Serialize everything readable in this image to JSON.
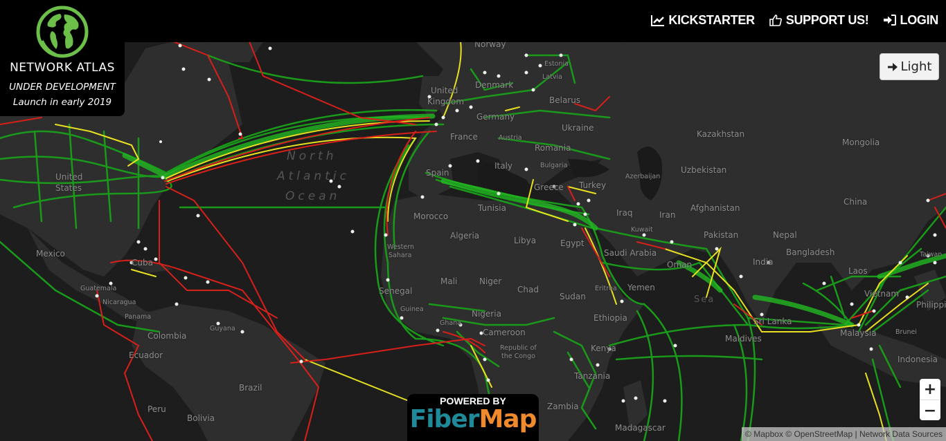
{
  "brand": {
    "title": "NETWORK ATLAS",
    "subtitle_line1": "UNDER DEVELOPMENT",
    "subtitle_line2": "Launch in early 2019",
    "logo_icon": "globe-logo-icon",
    "logo_color": "#6cc04a"
  },
  "nav": {
    "items": [
      {
        "label": "KICKSTARTER",
        "icon": "chart-line-icon"
      },
      {
        "label": "SUPPORT US!",
        "icon": "thumbs-up-icon"
      },
      {
        "label": "LOGIN",
        "icon": "sign-in-icon"
      }
    ]
  },
  "map": {
    "theme_toggle_label": "Light",
    "theme_toggle_icon": "arrow-right-icon",
    "zoom_in_label": "+",
    "zoom_out_label": "−",
    "attribution": {
      "mapbox": "© Mapbox",
      "osm": "© OpenStreetMap",
      "separator": " | ",
      "sources": "Network Data Sources"
    },
    "ocean_label": [
      "North",
      "Atlantic",
      "Ocean"
    ],
    "country_labels": [
      {
        "name": "Norway"
      },
      {
        "name": "Estonia"
      },
      {
        "name": "Latvia"
      },
      {
        "name": "Denmark"
      },
      {
        "name": "United"
      },
      {
        "name": "Kingdom"
      },
      {
        "name": "Belarus"
      },
      {
        "name": "Germany"
      },
      {
        "name": "Ukraine"
      },
      {
        "name": "France"
      },
      {
        "name": "Austria"
      },
      {
        "name": "Romania"
      },
      {
        "name": "Kazakhstan"
      },
      {
        "name": "Mongolia"
      },
      {
        "name": "Spain"
      },
      {
        "name": "Italy"
      },
      {
        "name": "Bulgaria"
      },
      {
        "name": "Uzbekistan"
      },
      {
        "name": "United"
      },
      {
        "name": "States"
      },
      {
        "name": "Greece"
      },
      {
        "name": "Turkey"
      },
      {
        "name": "Azerbaijan"
      },
      {
        "name": "Afghanistan"
      },
      {
        "name": "China"
      },
      {
        "name": "Tunisia"
      },
      {
        "name": "Morocco"
      },
      {
        "name": "Iraq"
      },
      {
        "name": "Iran"
      },
      {
        "name": "Kuwait"
      },
      {
        "name": "Pakistan"
      },
      {
        "name": "Nepal"
      },
      {
        "name": "Mexico"
      },
      {
        "name": "Algeria"
      },
      {
        "name": "Libya"
      },
      {
        "name": "Egypt"
      },
      {
        "name": "Saudi Arabia"
      },
      {
        "name": "Bangladesh"
      },
      {
        "name": "India"
      },
      {
        "name": "Western"
      },
      {
        "name": "Sahara"
      },
      {
        "name": "Oman"
      },
      {
        "name": "Taiwan"
      },
      {
        "name": "Cuba"
      },
      {
        "name": "Laos"
      },
      {
        "name": "Mali"
      },
      {
        "name": "Niger"
      },
      {
        "name": "Chad"
      },
      {
        "name": "Eritrea"
      },
      {
        "name": "Yemen"
      },
      {
        "name": "Guatemala"
      },
      {
        "name": "Senegal"
      },
      {
        "name": "Sudan"
      },
      {
        "name": "Vietnam"
      },
      {
        "name": "Nicaragua"
      },
      {
        "name": "Philippines"
      },
      {
        "name": "Guinea"
      },
      {
        "name": "Nigeria"
      },
      {
        "name": "Ethiopia"
      },
      {
        "name": "Sri Lanka"
      },
      {
        "name": "Panama"
      },
      {
        "name": "Ghana"
      },
      {
        "name": "Guyana"
      },
      {
        "name": "Maldives"
      },
      {
        "name": "Malaysia"
      },
      {
        "name": "Brunei"
      },
      {
        "name": "Colombia"
      },
      {
        "name": "Cameroon"
      },
      {
        "name": "Republic of"
      },
      {
        "name": "the Congo"
      },
      {
        "name": "Kenya"
      },
      {
        "name": "Ecuador"
      },
      {
        "name": "Indonesia"
      },
      {
        "name": "Tanzania"
      },
      {
        "name": "Brazil"
      },
      {
        "name": "Peru"
      },
      {
        "name": "Zambia"
      },
      {
        "name": "Bolivia"
      },
      {
        "name": "Madagascar"
      },
      {
        "name": "Sea"
      }
    ],
    "line_colors": {
      "green": "#1a9a1a",
      "yellow": "#e8e020",
      "red": "#d8201a",
      "node": "#e8f0e8"
    }
  },
  "powered_by": {
    "label": "POWERED BY",
    "brand_part1": "Fiber",
    "brand_part2": "Map"
  }
}
